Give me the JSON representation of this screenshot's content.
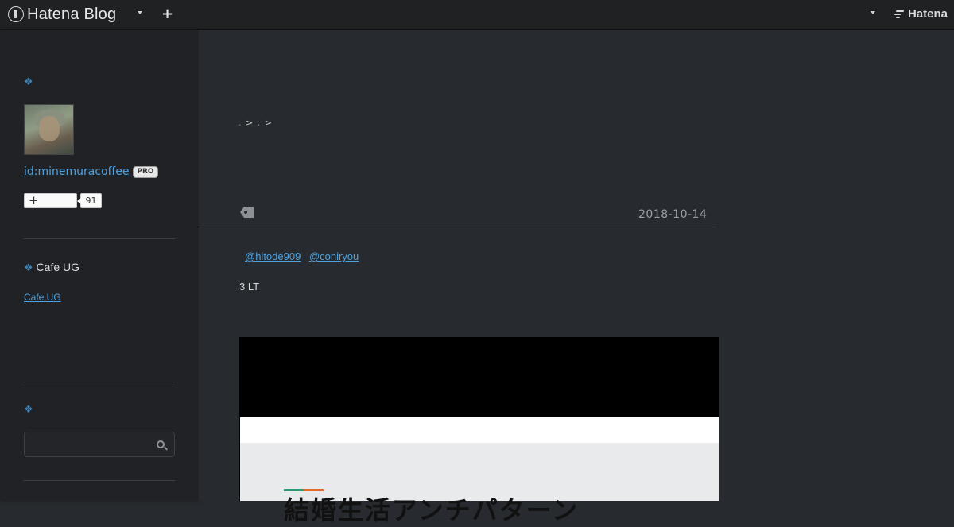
{
  "header": {
    "brand": "Hatena Blog",
    "plus": "+",
    "hatena_label": "Hatena"
  },
  "sidebar": {
    "section1_icon": "❖",
    "user_id": "id:minemuracoffee",
    "pro_badge": "PRO",
    "follow_plus": "+",
    "follow_count": "91",
    "section2_icon": "❖",
    "section2_title": "Cafe UG",
    "section2_link": "Cafe UG",
    "section3_icon": "❖",
    "search_placeholder": ""
  },
  "main": {
    "breadcrumb_sep1": ">",
    "breadcrumb_sep2": ">",
    "entry_date": "2018-10-14",
    "mentions": [
      "@hitode909",
      "@coniryou"
    ],
    "body_text": "3  LT",
    "embed_title": "結婚生活アンチパターン"
  },
  "colors": {
    "accent_green": "#2a9d78",
    "accent_orange": "#e26a2c",
    "link": "#4da3e0"
  }
}
